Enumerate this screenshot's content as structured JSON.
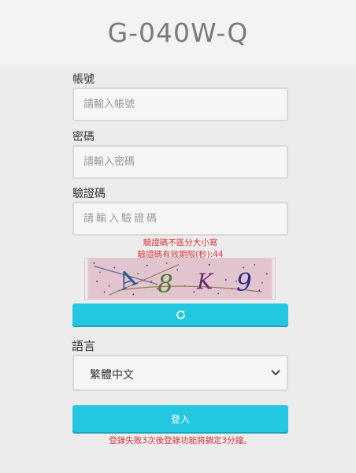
{
  "header": {
    "title": "G-040W-Q"
  },
  "form": {
    "account": {
      "label": "帳號",
      "placeholder": "請輸入帳號"
    },
    "password": {
      "label": "密碼",
      "placeholder": "請輸入密碼"
    },
    "captcha": {
      "label": "驗證碼",
      "placeholder": "請輸入驗證碼",
      "notice_case": "驗證碼不區分大小寫",
      "notice_expiry": "驗證碼有效期限(秒):44",
      "image_text": "A8K9"
    },
    "refresh_icon": "refresh-icon",
    "language": {
      "label": "語言",
      "selected": "繁體中文"
    },
    "login_button": "登入",
    "lockout_notice": "登錄失敗3次後登錄功能將鎖定3分鐘。"
  },
  "colors": {
    "accent": "#23c8e0",
    "warning": "#d9363e",
    "captcha_bg": "#e2c4cf"
  }
}
